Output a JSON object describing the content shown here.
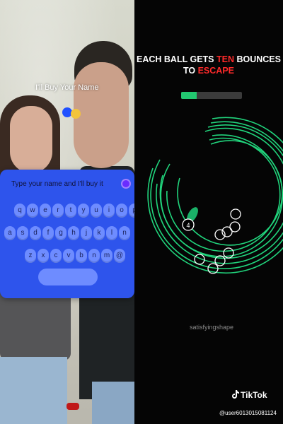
{
  "left_panel": {
    "caption": "I'll Buy Your Name",
    "keyboard": {
      "title": "Type your name and I'll buy it",
      "rows": [
        [
          "q",
          "w",
          "e",
          "r",
          "t",
          "y",
          "u",
          "i",
          "o",
          "p"
        ],
        [
          "a",
          "s",
          "d",
          "f",
          "g",
          "h",
          "j",
          "k",
          "l",
          "n"
        ],
        [
          "z",
          "x",
          "c",
          "v",
          "b",
          "n",
          "m",
          "@"
        ]
      ]
    }
  },
  "right_panel": {
    "headline": {
      "line1_part1": "EACH BALL GETS ",
      "line1_highlight": "TEN",
      "line1_part2": " BOUNCES",
      "line2_part1": "TO ",
      "line2_highlight": "ESCAPE"
    },
    "progress_fraction": 0.25,
    "moving_ball_number": "4",
    "watermark": "satisfyingshape",
    "colors": {
      "ring": "#21d47c",
      "progress_fill": "#22c870",
      "highlight": "#ff2a2a"
    }
  },
  "footer": {
    "brand": "TikTok",
    "username": "@user6013015081124",
    "brand_icon": "tiktok-note-icon"
  }
}
